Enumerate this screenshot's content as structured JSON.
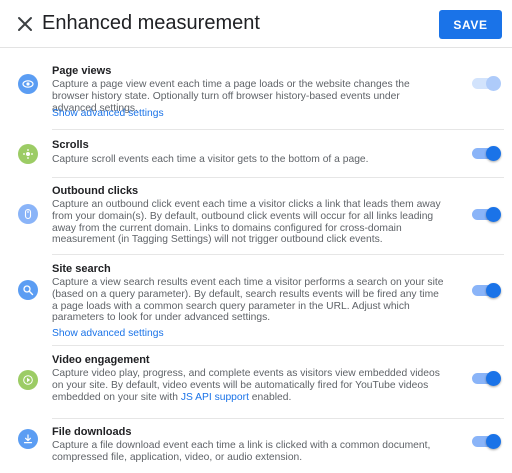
{
  "header": {
    "title": "Enhanced measurement",
    "save_label": "SAVE"
  },
  "colors": {
    "accent": "#1a73e8",
    "toggle_track": "#8ab4f8",
    "icon_blue": "#5b9df3",
    "icon_green": "#9ccc65"
  },
  "items": [
    {
      "title": "Page views",
      "icon": "eye-icon",
      "description": "Capture a page view event each time a page loads or the website changes the browser history state. Optionally turn off browser history-based events under advanced settings.",
      "link": "Show advanced settings",
      "toggle_on": true,
      "toggle_disabled": true
    },
    {
      "title": "Scrolls",
      "icon": "scroll-crosshair-icon",
      "description": "Capture scroll events each time a visitor gets to the bottom of a page.",
      "toggle_on": true
    },
    {
      "title": "Outbound clicks",
      "icon": "mouse-icon",
      "description": "Capture an outbound click event each time a visitor clicks a link that leads them away from your domain(s). By default, outbound click events will occur for all links leading away from the current domain. Links to domains configured for cross-domain measurement (in Tagging Settings) will not trigger outbound click events.",
      "toggle_on": true
    },
    {
      "title": "Site search",
      "icon": "search-icon",
      "description": "Capture a view search results event each time a visitor performs a search on your site (based on a query parameter). By default, search results events will be fired any time a page loads with a common search query parameter in the URL. Adjust which parameters to look for under advanced settings.",
      "link": "Show advanced settings",
      "toggle_on": true
    },
    {
      "title": "Video engagement",
      "icon": "play-icon",
      "description": "Capture video play, progress, and complete events as visitors view embedded videos on your site. By default, video events will be automatically fired for YouTube videos embedded on your site with",
      "description_link": "JS API support",
      "description_suffix": " enabled.",
      "toggle_on": true
    },
    {
      "title": "File downloads",
      "icon": "download-icon",
      "description": "Capture a file download event each time a link is clicked with a common document, compressed file, application, video, or audio extension.",
      "toggle_on": true
    }
  ]
}
